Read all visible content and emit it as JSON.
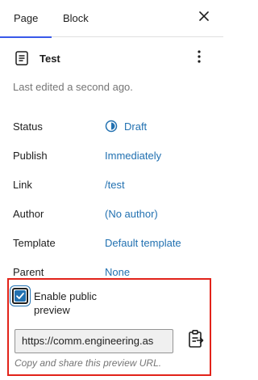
{
  "tabs": [
    {
      "label": "Page",
      "active": true
    },
    {
      "label": "Block",
      "active": false
    }
  ],
  "icons": {
    "close": "close-icon",
    "document": "page-icon",
    "more": "more-vertical-icon",
    "draft": "draft-status-icon",
    "copy": "clipboard-copy-icon"
  },
  "summary": {
    "title": "Test",
    "last_edited": "Last edited a second ago."
  },
  "properties": [
    {
      "label": "Status",
      "value": "Draft"
    },
    {
      "label": "Publish",
      "value": "Immediately"
    },
    {
      "label": "Link",
      "value": "/test"
    },
    {
      "label": "Author",
      "value": "(No author)"
    },
    {
      "label": "Template",
      "value": "Default template"
    },
    {
      "label": "Parent",
      "value": "None"
    }
  ],
  "preview": {
    "checkbox_label": "Enable public preview",
    "checked": true,
    "url": "https://comm.engineering.as",
    "help": "Copy and share this preview URL."
  },
  "colors": {
    "accent": "#3858e9",
    "link": "#2271b1",
    "highlight": "#e2231a",
    "muted": "#757575"
  }
}
